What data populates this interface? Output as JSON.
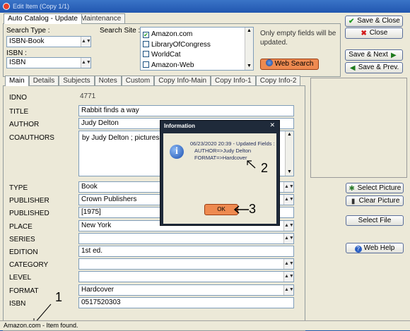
{
  "window": {
    "title": "Edit Item (Copy 1/1)"
  },
  "top_tabs": [
    "Auto Catalog - Update",
    "Maintenance"
  ],
  "search_type": {
    "label": "Search Type :",
    "value": "ISBN-Book"
  },
  "isbn_select": {
    "label": "ISBN :",
    "value": "ISBN"
  },
  "search_site": {
    "label": "Search Site :",
    "sites": [
      {
        "name": "Amazon.com",
        "checked": true
      },
      {
        "name": "LibraryOfCongress",
        "checked": false
      },
      {
        "name": "WorldCat",
        "checked": false
      },
      {
        "name": "Amazon-Web",
        "checked": false
      }
    ]
  },
  "note": {
    "line1": "Only empty fields will be",
    "line2": "updated."
  },
  "web_search_label": "Web Search",
  "buttons": {
    "save_close": "Save & Close",
    "close": "Close",
    "save_next": "Save & Next",
    "save_prev": "Save & Prev.",
    "select_picture": "Select Picture",
    "clear_picture": "Clear Picture",
    "select_file": "Select File",
    "web_help": "Web Help"
  },
  "detail_tabs": [
    "Main",
    "Details",
    "Subjects",
    "Notes",
    "Custom",
    "Copy Info-Main",
    "Copy Info-1",
    "Copy Info-2"
  ],
  "fields": {
    "idno": {
      "label": "IDNO",
      "value": "4771"
    },
    "title": {
      "label": "TITLE",
      "value": "Rabbit finds a way"
    },
    "author": {
      "label": "AUTHOR",
      "value": "Judy Delton"
    },
    "coauthors": {
      "label": "COAUTHORS",
      "value": "by Judy Delton ; pictures"
    },
    "type": {
      "label": "TYPE",
      "value": "Book"
    },
    "publisher": {
      "label": "PUBLISHER",
      "value": "Crown Publishers"
    },
    "published": {
      "label": "PUBLISHED",
      "value": "[1975]"
    },
    "place": {
      "label": "PLACE",
      "value": "New York"
    },
    "series": {
      "label": "SERIES",
      "value": ""
    },
    "edition": {
      "label": "EDITION",
      "value": "1st ed."
    },
    "category": {
      "label": "CATEGORY",
      "value": ""
    },
    "level": {
      "label": "LEVEL",
      "value": ""
    },
    "format": {
      "label": "FORMAT",
      "value": "Hardcover"
    },
    "isbn": {
      "label": "ISBN",
      "value": "0517520303"
    }
  },
  "dialog": {
    "title": "Information",
    "line1": "06/23/2020 20:39 - Updated Fields :",
    "line2": "AUTHOR=>Judy Delton",
    "line3": "FORMAT=>Hardcover",
    "ok": "OK"
  },
  "annotations": {
    "n1": "1",
    "n2": "2",
    "n3": "3"
  },
  "status_bar": "Amazon.com - Item found.",
  "colors": {
    "accent_button": "#ee8a50",
    "dialog_frame": "#1f2a3a",
    "title_bar": "#2257b0"
  }
}
